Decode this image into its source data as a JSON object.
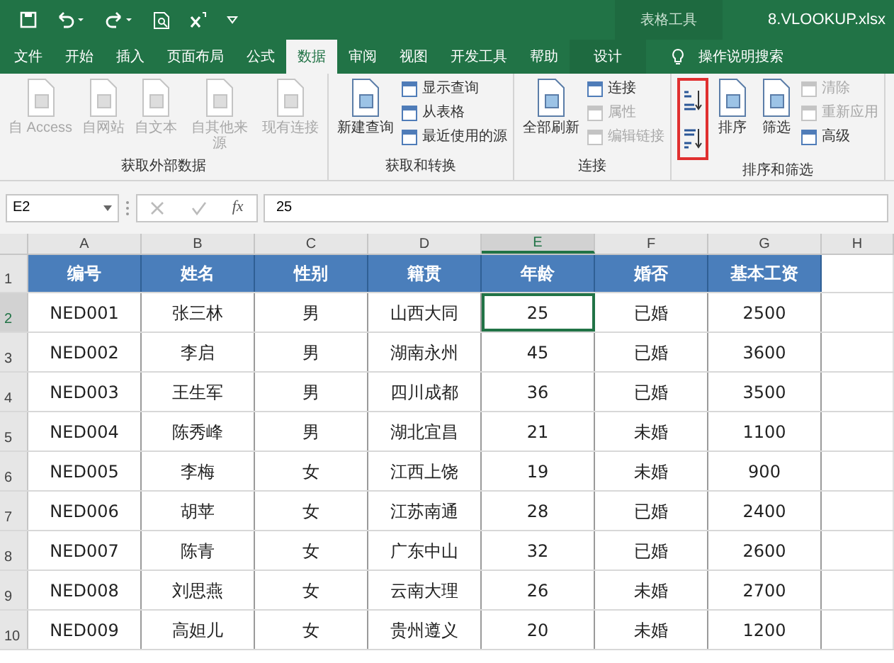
{
  "window": {
    "title": "8.VLOOKUP.xlsx",
    "context_group": "表格工具"
  },
  "tabs": [
    {
      "label": "文件",
      "selected": false,
      "contextual": false
    },
    {
      "label": "开始",
      "selected": false,
      "contextual": false
    },
    {
      "label": "插入",
      "selected": false,
      "contextual": false
    },
    {
      "label": "页面布局",
      "selected": false,
      "contextual": false
    },
    {
      "label": "公式",
      "selected": false,
      "contextual": false
    },
    {
      "label": "数据",
      "selected": true,
      "contextual": false
    },
    {
      "label": "审阅",
      "selected": false,
      "contextual": false
    },
    {
      "label": "视图",
      "selected": false,
      "contextual": false
    },
    {
      "label": "开发工具",
      "selected": false,
      "contextual": false
    },
    {
      "label": "帮助",
      "selected": false,
      "contextual": false
    },
    {
      "label": "设计",
      "selected": false,
      "contextual": true
    }
  ],
  "tell_me": "操作说明搜索",
  "ribbon": {
    "groups": [
      {
        "label": "获取外部数据",
        "commands": [
          {
            "kind": "large",
            "label": "自 Access",
            "disabled": true
          },
          {
            "kind": "large",
            "label": "自网站",
            "disabled": true
          },
          {
            "kind": "large",
            "label": "自文本",
            "disabled": true
          },
          {
            "kind": "large",
            "label": "自其他来源",
            "disabled": true
          },
          {
            "kind": "large",
            "label": "现有连接",
            "disabled": true
          }
        ]
      },
      {
        "label": "获取和转换",
        "commands": [
          {
            "kind": "large",
            "label": "新建查询",
            "disabled": false
          },
          {
            "kind": "small",
            "label": "显示查询",
            "disabled": false
          },
          {
            "kind": "small",
            "label": "从表格",
            "disabled": false
          },
          {
            "kind": "small",
            "label": "最近使用的源",
            "disabled": false
          }
        ]
      },
      {
        "label": "连接",
        "commands": [
          {
            "kind": "large",
            "label": "全部刷新",
            "disabled": false
          },
          {
            "kind": "small",
            "label": "连接",
            "disabled": false
          },
          {
            "kind": "small",
            "label": "属性",
            "disabled": true
          },
          {
            "kind": "small",
            "label": "编辑链接",
            "disabled": true
          }
        ]
      },
      {
        "label": "排序和筛选",
        "commands": [
          {
            "kind": "sort_pair",
            "highlighted": true
          },
          {
            "kind": "large",
            "label": "排序",
            "disabled": false
          },
          {
            "kind": "large",
            "label": "筛选",
            "disabled": false
          },
          {
            "kind": "small",
            "label": "清除",
            "disabled": true
          },
          {
            "kind": "small",
            "label": "重新应用",
            "disabled": true
          },
          {
            "kind": "small",
            "label": "高级",
            "disabled": false
          }
        ]
      }
    ]
  },
  "formula_bar": {
    "name_box": "E2",
    "function_button": "fx",
    "formula": "25"
  },
  "table": {
    "columns": [
      {
        "label": "A",
        "selected": false
      },
      {
        "label": "B",
        "selected": false
      },
      {
        "label": "C",
        "selected": false
      },
      {
        "label": "D",
        "selected": false
      },
      {
        "label": "E",
        "selected": true
      },
      {
        "label": "F",
        "selected": false
      },
      {
        "label": "G",
        "selected": false
      },
      {
        "label": "H",
        "selected": false
      }
    ],
    "rows": [
      {
        "number": "1",
        "kind": "header",
        "selected": false,
        "cells": [
          "编号",
          "姓名",
          "性别",
          "籍贯",
          "年龄",
          "婚否",
          "基本工资"
        ]
      },
      {
        "number": "2",
        "kind": "data",
        "selected": true,
        "cells": [
          "NED001",
          "张三林",
          "男",
          "山西大同",
          "25",
          "已婚",
          "2500"
        ]
      },
      {
        "number": "3",
        "kind": "data",
        "selected": false,
        "cells": [
          "NED002",
          "李启",
          "男",
          "湖南永州",
          "45",
          "已婚",
          "3600"
        ]
      },
      {
        "number": "4",
        "kind": "data",
        "selected": false,
        "cells": [
          "NED003",
          "王生军",
          "男",
          "四川成都",
          "36",
          "已婚",
          "3500"
        ]
      },
      {
        "number": "5",
        "kind": "data",
        "selected": false,
        "cells": [
          "NED004",
          "陈秀峰",
          "男",
          "湖北宜昌",
          "21",
          "未婚",
          "1100"
        ]
      },
      {
        "number": "6",
        "kind": "data",
        "selected": false,
        "cells": [
          "NED005",
          "李梅",
          "女",
          "江西上饶",
          "19",
          "未婚",
          "900"
        ]
      },
      {
        "number": "7",
        "kind": "data",
        "selected": false,
        "cells": [
          "NED006",
          "胡苹",
          "女",
          "江苏南通",
          "28",
          "已婚",
          "2400"
        ]
      },
      {
        "number": "8",
        "kind": "data",
        "selected": false,
        "cells": [
          "NED007",
          "陈青",
          "女",
          "广东中山",
          "32",
          "已婚",
          "2600"
        ]
      },
      {
        "number": "9",
        "kind": "data",
        "selected": false,
        "cells": [
          "NED008",
          "刘思燕",
          "女",
          "云南大理",
          "26",
          "未婚",
          "2700"
        ]
      },
      {
        "number": "10",
        "kind": "data",
        "selected": false,
        "cells": [
          "NED009",
          "高妲儿",
          "女",
          "贵州遵义",
          "20",
          "未婚",
          "1200"
        ]
      }
    ]
  }
}
